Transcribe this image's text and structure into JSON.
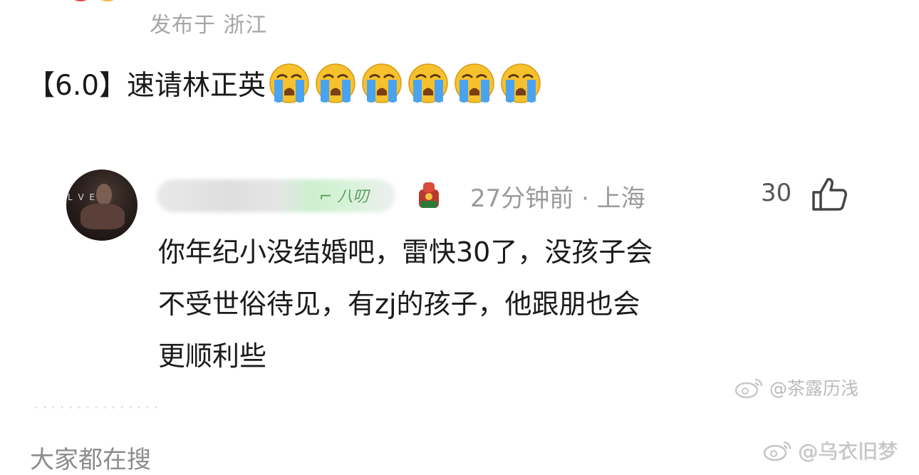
{
  "post": {
    "location_text": "发布于 浙江",
    "score": "【6.0】",
    "body": "速请林正英",
    "emoji": [
      "crying-face",
      "crying-face",
      "crying-face",
      "crying-face",
      "crying-face",
      "crying-face"
    ]
  },
  "reply": {
    "avatar_text": "L V E",
    "time_location": "27分钟前 · 上海",
    "like_count": "30",
    "lines": [
      "你年纪小没结婚吧，雷快30了，没孩子会",
      "不受世俗待见，有zj的孩子，他跟朋也会",
      "更顺利些"
    ]
  },
  "watermarks": [
    "@茶露历浅",
    "@乌衣旧梦"
  ],
  "footer": {
    "search_label": "大家都在搜"
  },
  "colors": {
    "secondary_text": "#9a9a9a",
    "body_text": "#1b1b1b",
    "emoji_yellow": "#f6c12c",
    "tear_blue": "#4aa3f0"
  }
}
